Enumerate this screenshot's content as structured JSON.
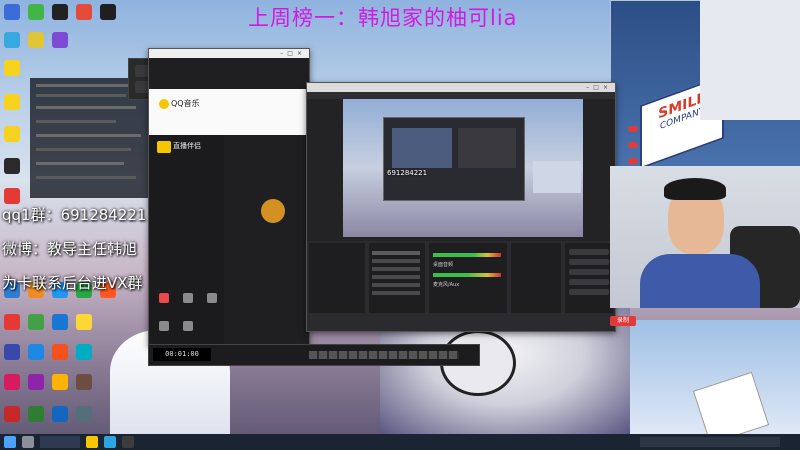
{
  "overlay": {
    "stream_title": "上周榜一：韩旭家的柚可lia",
    "qq_group": "qq1群：691284221",
    "weibo": "微博：教导主任韩旭",
    "contact": "为卡联系后台进VX群"
  },
  "qq_music": {
    "brand": "QQ音乐",
    "sidebar_header": "直播伴侣"
  },
  "obs": {
    "mixer_labels": [
      "桌面音频",
      "麦克风/Aux"
    ],
    "preview_overlay_text": "691284221"
  },
  "brand_sign": {
    "line1": "SMILE",
    "line2": "COMPANY"
  },
  "media_player": {
    "time": "00:01:00"
  },
  "record_button": {
    "label": "录制"
  },
  "colors": {
    "title_magenta": "#d21be0",
    "obs_bg": "#232326",
    "taskbar": "#1b2433",
    "record_red": "#e03a3a"
  }
}
